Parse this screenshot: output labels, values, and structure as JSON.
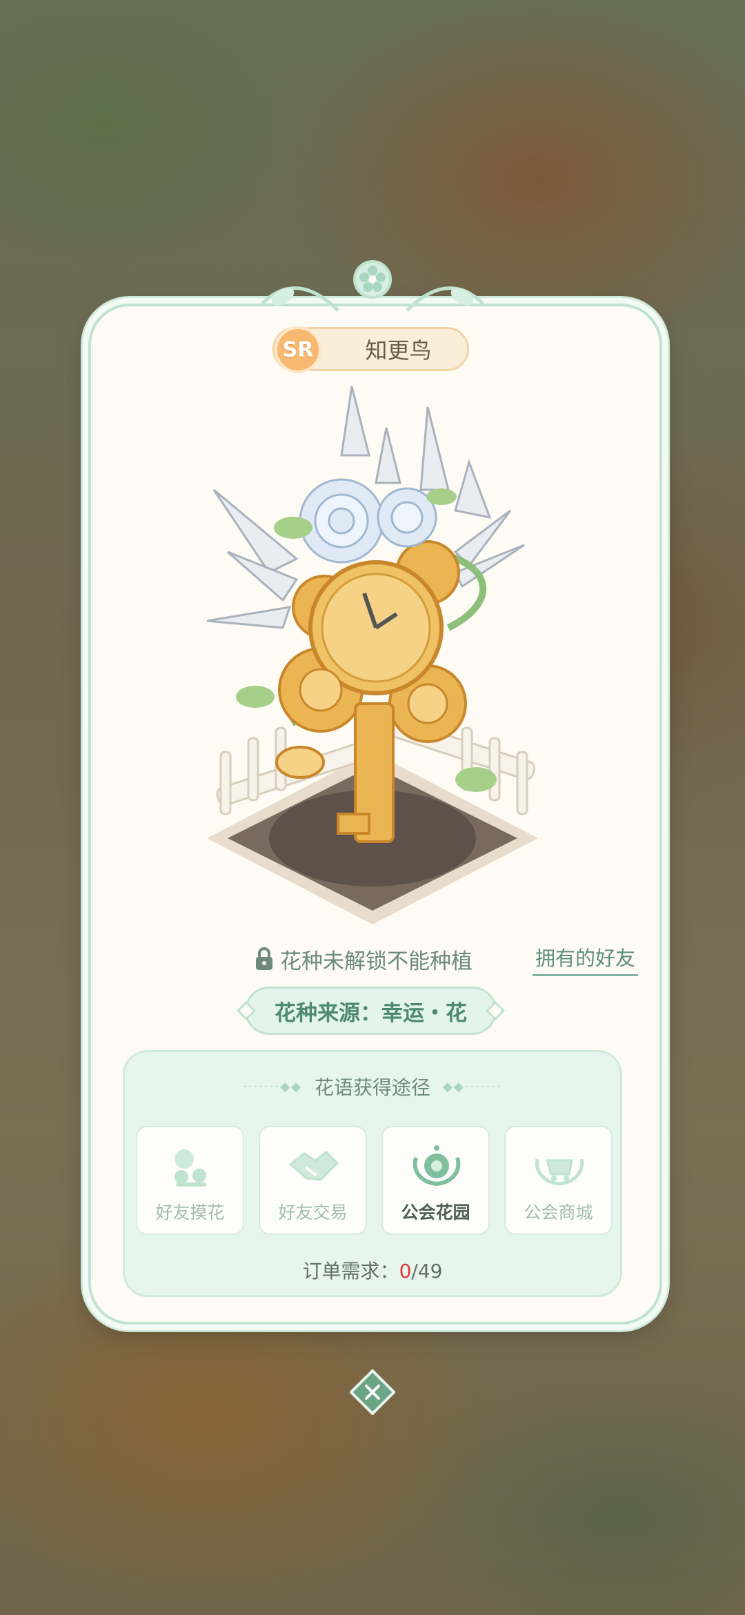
{
  "flower": {
    "rarity": "SR",
    "name": "知更鸟"
  },
  "status": {
    "lock_text": "花种未解锁不能种植",
    "friends_link": "拥有的好友"
  },
  "source": {
    "text": "花种来源：幸运・花"
  },
  "acquire": {
    "title": "花语获得途径",
    "methods": [
      {
        "label": "好友摸花",
        "icon": "friend-flower-icon",
        "active": false
      },
      {
        "label": "好友交易",
        "icon": "handshake-icon",
        "active": false
      },
      {
        "label": "公会花园",
        "icon": "guild-garden-icon",
        "active": true
      },
      {
        "label": "公会商城",
        "icon": "guild-shop-icon",
        "active": false
      }
    ],
    "order_label": "订单需求：",
    "order_current": "0",
    "order_total": "/49"
  },
  "colors": {
    "accent_green": "#4e8a6f",
    "card_bg": "#fdfbf3",
    "rarity_orange": "#f7b870",
    "order_red": "#e0353a"
  }
}
